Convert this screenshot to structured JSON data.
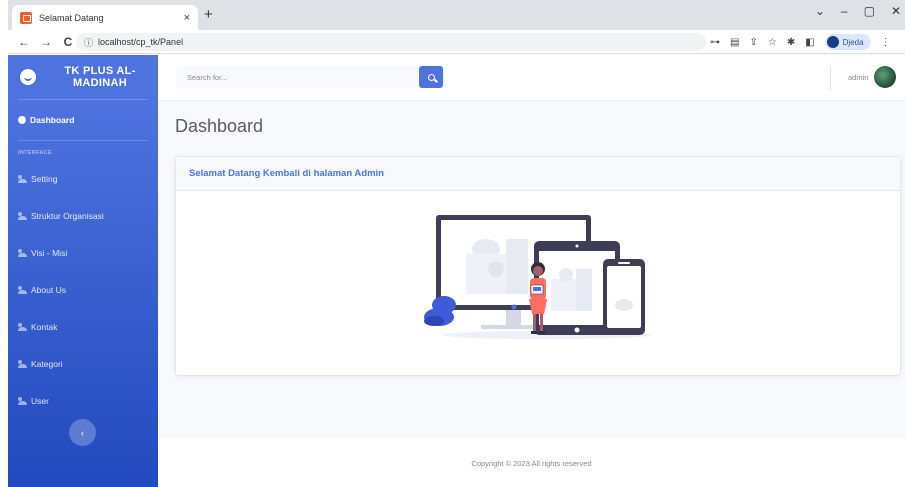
{
  "browser": {
    "tab_title": "Selamat Datang",
    "tab_close": "×",
    "new_tab": "+",
    "url": "localhost/cp_tk/Panel",
    "profile_name": "Djeda",
    "controls": {
      "minimize": "–",
      "maximize": "▢",
      "close": "✕",
      "dropdown": "⌄"
    },
    "nav": {
      "back": "←",
      "forward": "→",
      "reload": "C"
    }
  },
  "sidebar": {
    "brand": "TK PLUS AL-MADINAH",
    "dashboard_label": "Dashboard",
    "heading": "INTERFACE",
    "items": [
      {
        "label": "Setting"
      },
      {
        "label": "Struktur Organisasi"
      },
      {
        "label": "Visi - Misi"
      },
      {
        "label": "About Us"
      },
      {
        "label": "Kontak"
      },
      {
        "label": "Kategori"
      },
      {
        "label": "User"
      }
    ],
    "toggle_symbol": "‹"
  },
  "topbar": {
    "search_placeholder": "Search for...",
    "user_name": "admin"
  },
  "main": {
    "title": "Dashboard",
    "card_header": "Selamat Datang Kembali di halaman Admin"
  },
  "footer": {
    "text": "Copyright © 2023 All rights reserved"
  },
  "colors": {
    "primary": "#4e73df",
    "sidebar_dark": "#224abe",
    "text_muted": "#858796",
    "title": "#5a5c69"
  }
}
